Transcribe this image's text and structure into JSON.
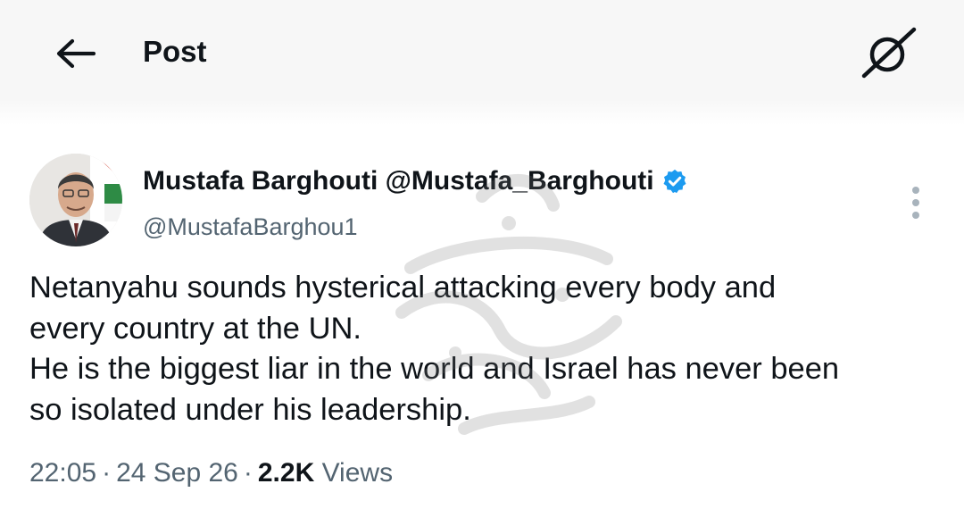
{
  "header": {
    "title": "Post",
    "back_icon": "arrow-left-icon",
    "grok_icon": "grok-icon"
  },
  "tweet": {
    "author_display": "Mustafa Barghouti @Mustafa_Barghouti",
    "verified_icon": "verified-badge-icon",
    "verified_color": "#1d9bf0",
    "handle": "@MustafaBarghou1",
    "text_lines": [
      "Netanyahu sounds hysterical attacking every body and",
      "every country at the UN.",
      "He is the biggest liar in the world and Israel has never been",
      "so isolated under his leadership."
    ],
    "time": "22:05",
    "date": "24 Sep 26",
    "views_count": "2.2K",
    "views_label": "Views"
  },
  "colors": {
    "text_primary": "#0f1419",
    "text_secondary": "#536471",
    "header_bg": "#f7f7f7"
  }
}
